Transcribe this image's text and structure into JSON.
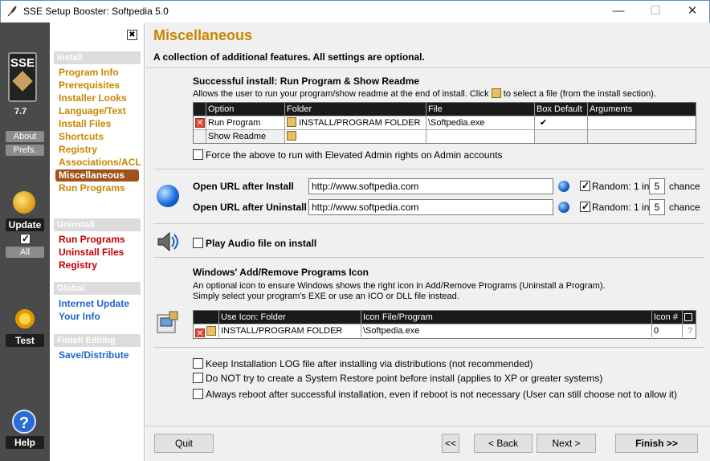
{
  "window": {
    "title": "SSE Setup Booster: Softpedia 5.0",
    "minimize": "—",
    "maximize": "☐",
    "close": "✕"
  },
  "sidebar": {
    "logo_text": "SSE",
    "version": "7.7",
    "about": "About",
    "prefs": "Prefs.",
    "update": "Update",
    "all": "All",
    "test": "Test",
    "help": "Help"
  },
  "nav": {
    "close_glyph": "✖",
    "install_header": "Install",
    "install_items": [
      "Program Info",
      "Prerequisites",
      "Installer Looks",
      "Language/Text",
      "Install Files",
      "Shortcuts",
      "Registry",
      "Associations/ACL",
      "Miscellaneous",
      "Run Programs"
    ],
    "uninstall_header": "Uninstall",
    "uninstall_items": [
      "Run Programs",
      "Uninstall Files",
      "Registry"
    ],
    "global_header": "Global",
    "global_items": [
      "Internet Update",
      "Your Info"
    ],
    "finish_header": "Finish Editing",
    "finish_items": [
      "Save/Distribute"
    ]
  },
  "page": {
    "title": "Miscellaneous",
    "subtitle": "A collection of additional features. All settings are optional."
  },
  "run_section": {
    "heading": "Successful install: Run Program & Show Readme",
    "desc_before": "Allows the user to run your program/show readme at the end of install. Click",
    "desc_after": "to select a file (from the install section).",
    "columns": [
      "Option",
      "Folder",
      "File",
      "Box Default",
      "Arguments"
    ],
    "rows": [
      {
        "option": "Run Program",
        "folder": "INSTALL/PROGRAM FOLDER",
        "file": "\\Softpedia.exe",
        "box_default": "✔",
        "arguments": ""
      },
      {
        "option": "Show Readme",
        "folder": "",
        "file": "",
        "box_default": "",
        "arguments": ""
      }
    ],
    "elevated_label": "Force the above to run with Elevated Admin rights on Admin accounts"
  },
  "url_section": {
    "install_label": "Open URL after Install",
    "install_url": "http://www.softpedia.com",
    "uninstall_label": "Open URL after Uninstall",
    "uninstall_url": "http://www.softpedia.com",
    "random_label": "Random: 1 in",
    "install_random": "5",
    "uninstall_random": "5",
    "chance": "chance"
  },
  "audio_section": {
    "label": "Play Audio file on install"
  },
  "icon_section": {
    "heading": "Windows' Add/Remove Programs Icon",
    "desc1": "An optional icon to ensure Windows shows the right icon in Add/Remove Programs (Uninstall a Program).",
    "desc2": "Simply select your program's EXE or use an ICO or DLL file instead.",
    "columns": [
      "Use Icon: Folder",
      "Icon File/Program",
      "Icon #"
    ],
    "row": {
      "folder": "INSTALL/PROGRAM FOLDER",
      "file": "\\Softpedia.exe",
      "icon_num": "0",
      "q": "?"
    }
  },
  "options": [
    "Keep Installation LOG file after installing via distributions (not recommended)",
    "Do NOT try to create a System Restore point before install (applies to XP or greater systems)",
    "Always reboot after successful installation, even if reboot is not necessary (User can still choose not to allow it)"
  ],
  "footer": {
    "quit": "Quit",
    "first": "<<",
    "back": "< Back",
    "next": "Next  >",
    "finish": "Finish  >>"
  },
  "colors": {
    "title": "#c98500",
    "nav_selected": "#a0521c",
    "nav_install": "#c98500",
    "nav_uninstall": "#c00000",
    "nav_global": "#2066c8"
  }
}
